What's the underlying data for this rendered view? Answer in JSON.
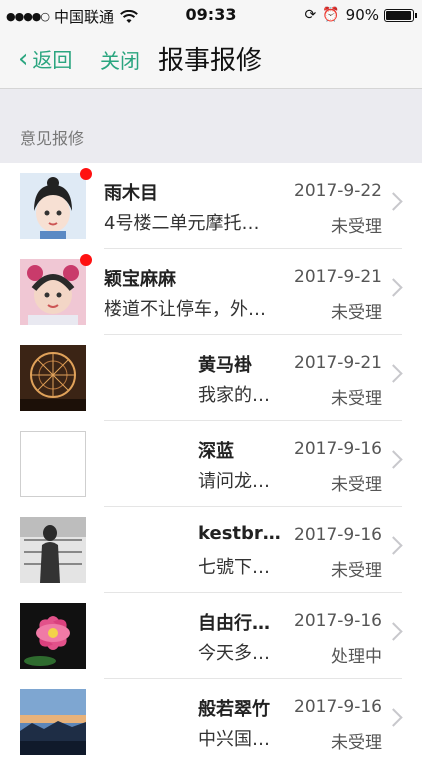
{
  "status_bar": {
    "carrier": "中国联通",
    "time": "09:33",
    "battery": "90%"
  },
  "nav": {
    "back": "返回",
    "close": "关闭",
    "title": "报事报修"
  },
  "section": {
    "title": "意见报修"
  },
  "items": [
    {
      "name": "雨木目",
      "message": "4号楼二单元摩托…",
      "date": "2017-9-22",
      "status": "未受理"
    },
    {
      "name": "颖宝麻麻",
      "message": "楼道不让停车，外…",
      "date": "2017-9-21",
      "status": "未受理"
    },
    {
      "name": "黄马褂",
      "message": "我家的…",
      "date": "2017-9-21",
      "status": "未受理"
    },
    {
      "name": "深蓝",
      "message": "请问龙…",
      "date": "2017-9-16",
      "status": "未受理"
    },
    {
      "name": "kestbr…",
      "message": "七號下…",
      "date": "2017-9-16",
      "status": "未受理"
    },
    {
      "name": "自由行…",
      "message": "今天多…",
      "date": "2017-9-16",
      "status": "处理中"
    },
    {
      "name": "般若翠竹",
      "message": "中兴国…",
      "date": "2017-9-16",
      "status": "未受理"
    }
  ]
}
